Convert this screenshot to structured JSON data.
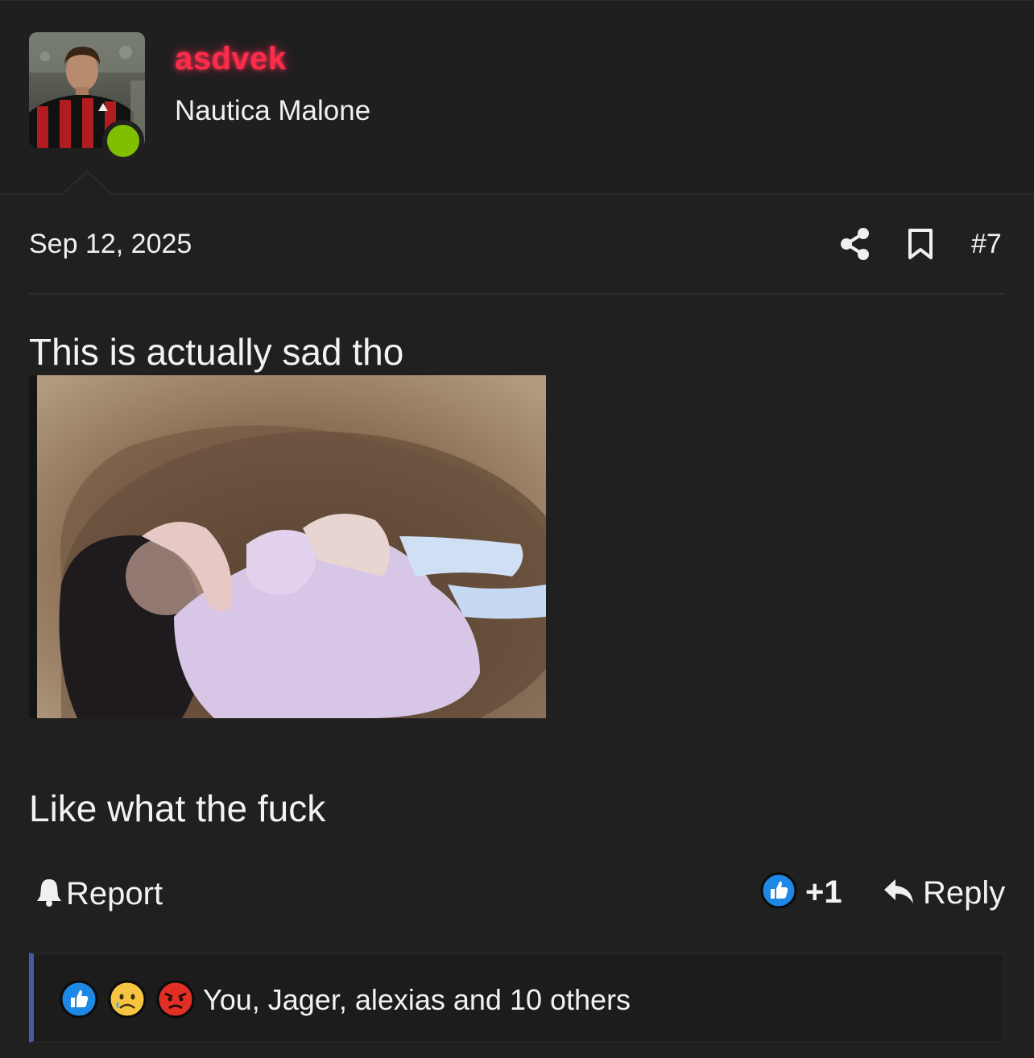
{
  "user": {
    "username": "asdvek",
    "user_title": "Nautica Malone",
    "avatar_icon": "user-avatar",
    "online": true
  },
  "post": {
    "date": "Sep 12, 2025",
    "number": "#7",
    "text_line1": "This is actually sad tho",
    "text_line2": "Like what the fuck",
    "image_icon": "post-image"
  },
  "actions": {
    "report_label": "Report",
    "report_icon": "bell-icon",
    "like_count": "+1",
    "like_icon": "thumbs-up-icon",
    "reply_label": "Reply",
    "reply_icon": "reply-arrow-icon",
    "share_icon": "share-icon",
    "bookmark_icon": "bookmark-icon"
  },
  "reactions": {
    "icons": [
      "thumbs-up-icon",
      "sad-face-icon",
      "angry-face-icon"
    ],
    "summary": "You, Jager, alexias and 10 others"
  },
  "colors": {
    "background": "#202020",
    "username": "#ff2b4b",
    "online": "#7fbf00",
    "reactions_accent": "#4a58a8",
    "like_blue": "#1e88e5"
  }
}
